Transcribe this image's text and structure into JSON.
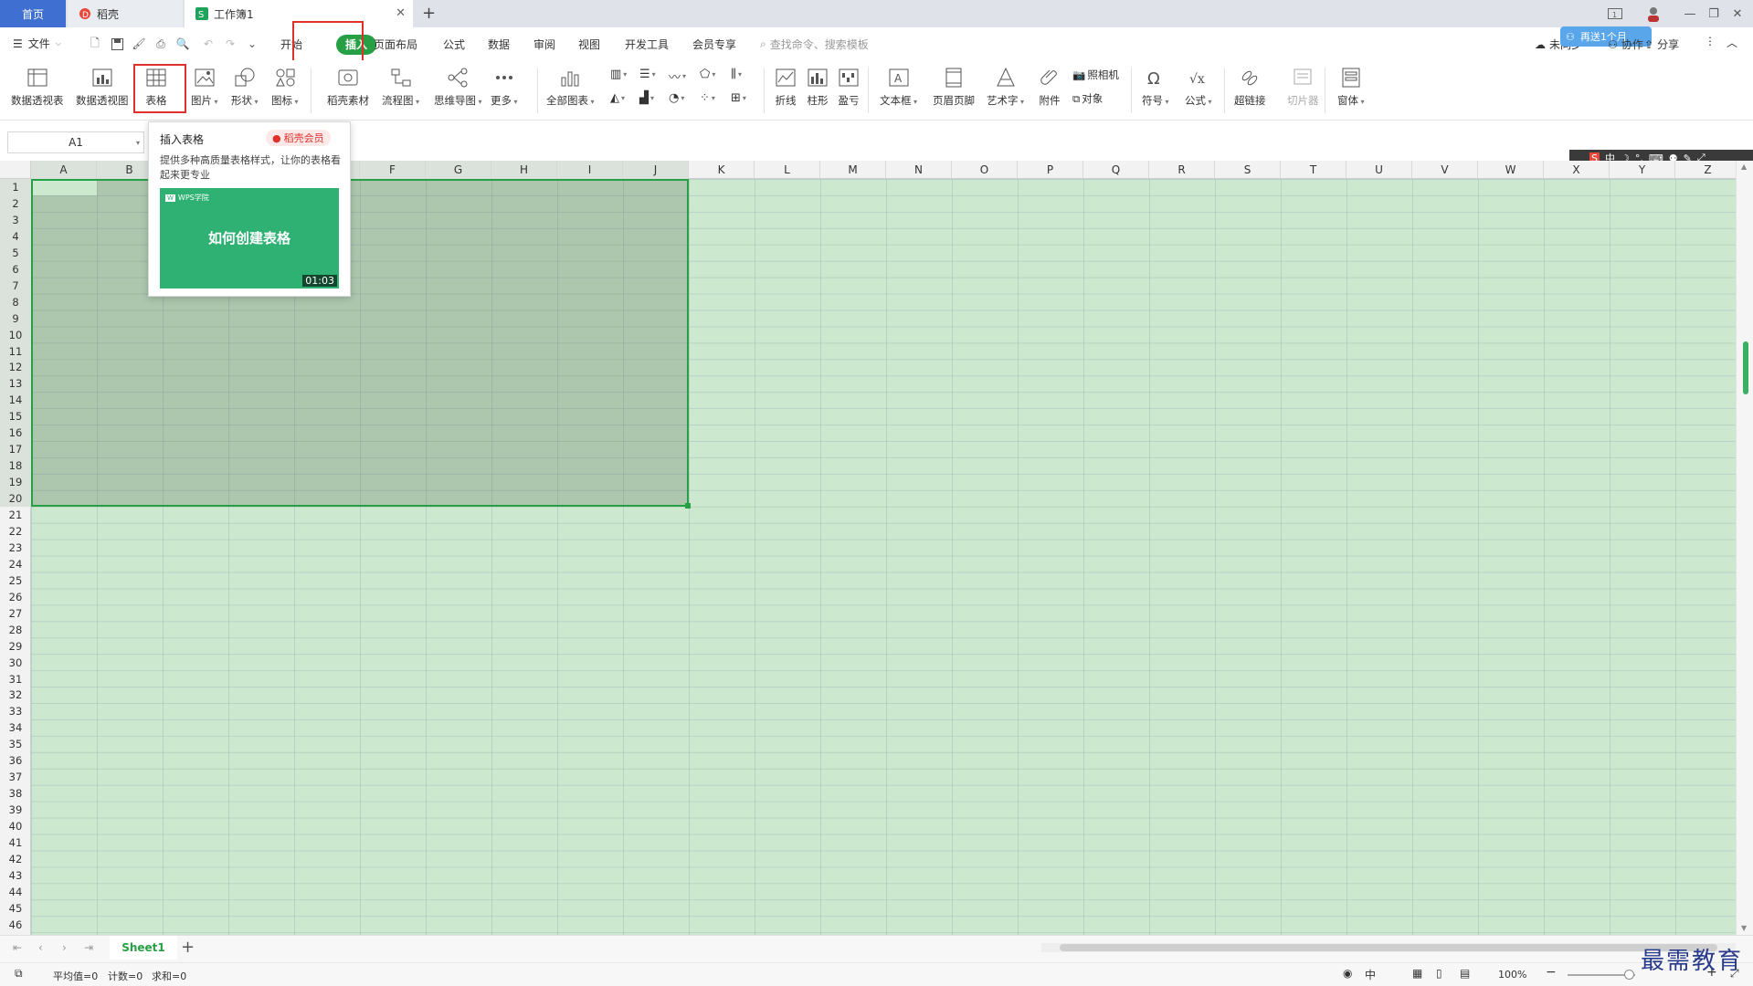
{
  "tabs": {
    "home": "首页",
    "daoke": "稻壳",
    "workbook": "工作簿1",
    "new_tab": "+"
  },
  "menu": {
    "file": "文件",
    "items": [
      "开始",
      "插入",
      "页面布局",
      "公式",
      "数据",
      "审阅",
      "视图",
      "开发工具",
      "会员专享"
    ],
    "active": "插入",
    "search_placeholder": "查找命令、搜索模板",
    "cloud_label": "未同步",
    "collab_label": "协作",
    "share_label": "分享",
    "badge_text": "再送1个月"
  },
  "ribbon": {
    "buttons": [
      {
        "id": "pivot-table",
        "label": "数据透视表",
        "dropdown": false
      },
      {
        "id": "pivot-chart",
        "label": "数据透视图",
        "dropdown": false
      },
      {
        "id": "table",
        "label": "表格",
        "dropdown": false
      },
      {
        "id": "picture",
        "label": "图片",
        "dropdown": true
      },
      {
        "id": "shape",
        "label": "形状",
        "dropdown": true
      },
      {
        "id": "icon",
        "label": "图标",
        "dropdown": true
      },
      {
        "id": "daoke-material",
        "label": "稻壳素材",
        "dropdown": false
      },
      {
        "id": "flowchart",
        "label": "流程图",
        "dropdown": true
      },
      {
        "id": "mindmap",
        "label": "思维导图",
        "dropdown": true
      },
      {
        "id": "more",
        "label": "更多",
        "dropdown": true
      },
      {
        "id": "all-charts",
        "label": "全部图表",
        "dropdown": true
      },
      {
        "id": "sparkline-line",
        "label": "折线",
        "dropdown": false
      },
      {
        "id": "sparkline-column",
        "label": "柱形",
        "dropdown": false
      },
      {
        "id": "sparkline-winloss",
        "label": "盈亏",
        "dropdown": false
      },
      {
        "id": "textbox",
        "label": "文本框",
        "dropdown": true
      },
      {
        "id": "header-footer",
        "label": "页眉页脚",
        "dropdown": false
      },
      {
        "id": "wordart",
        "label": "艺术字",
        "dropdown": true
      },
      {
        "id": "attachment",
        "label": "附件",
        "dropdown": false
      },
      {
        "id": "symbol",
        "label": "符号",
        "dropdown": true
      },
      {
        "id": "equation",
        "label": "公式",
        "dropdown": true
      },
      {
        "id": "hyperlink",
        "label": "超链接",
        "dropdown": false
      },
      {
        "id": "slicer",
        "label": "切片器",
        "dropdown": false
      },
      {
        "id": "form",
        "label": "窗体",
        "dropdown": true
      }
    ],
    "camera": "照相机",
    "object": "对象"
  },
  "namebox": {
    "value": "A1"
  },
  "popup": {
    "title": "插入表格",
    "badge": "稻壳会员",
    "description": "提供多种高质量表格样式，让你的表格看起来更专业",
    "thumb_brand": "WPS学院",
    "thumb_title": "如何创建表格",
    "duration": "01:03"
  },
  "columns": [
    "A",
    "B",
    "C",
    "D",
    "E",
    "F",
    "G",
    "H",
    "I",
    "J",
    "K",
    "L",
    "M",
    "N",
    "O",
    "P",
    "Q",
    "R",
    "S",
    "T",
    "U",
    "V",
    "W",
    "X",
    "Y",
    "Z"
  ],
  "rows": 46,
  "sheets": {
    "active": "Sheet1",
    "add": "+"
  },
  "status": {
    "average": "平均值=0",
    "count": "计数=0",
    "sum": "求和=0",
    "zoom": "100%",
    "zoom_level": 1.0
  },
  "watermark": "最需教育",
  "colors": {
    "accent": "#27a045",
    "highlight_box": "#e0302c",
    "cell_bg": "#cce8cf",
    "home_tab": "#3f6fd0"
  }
}
